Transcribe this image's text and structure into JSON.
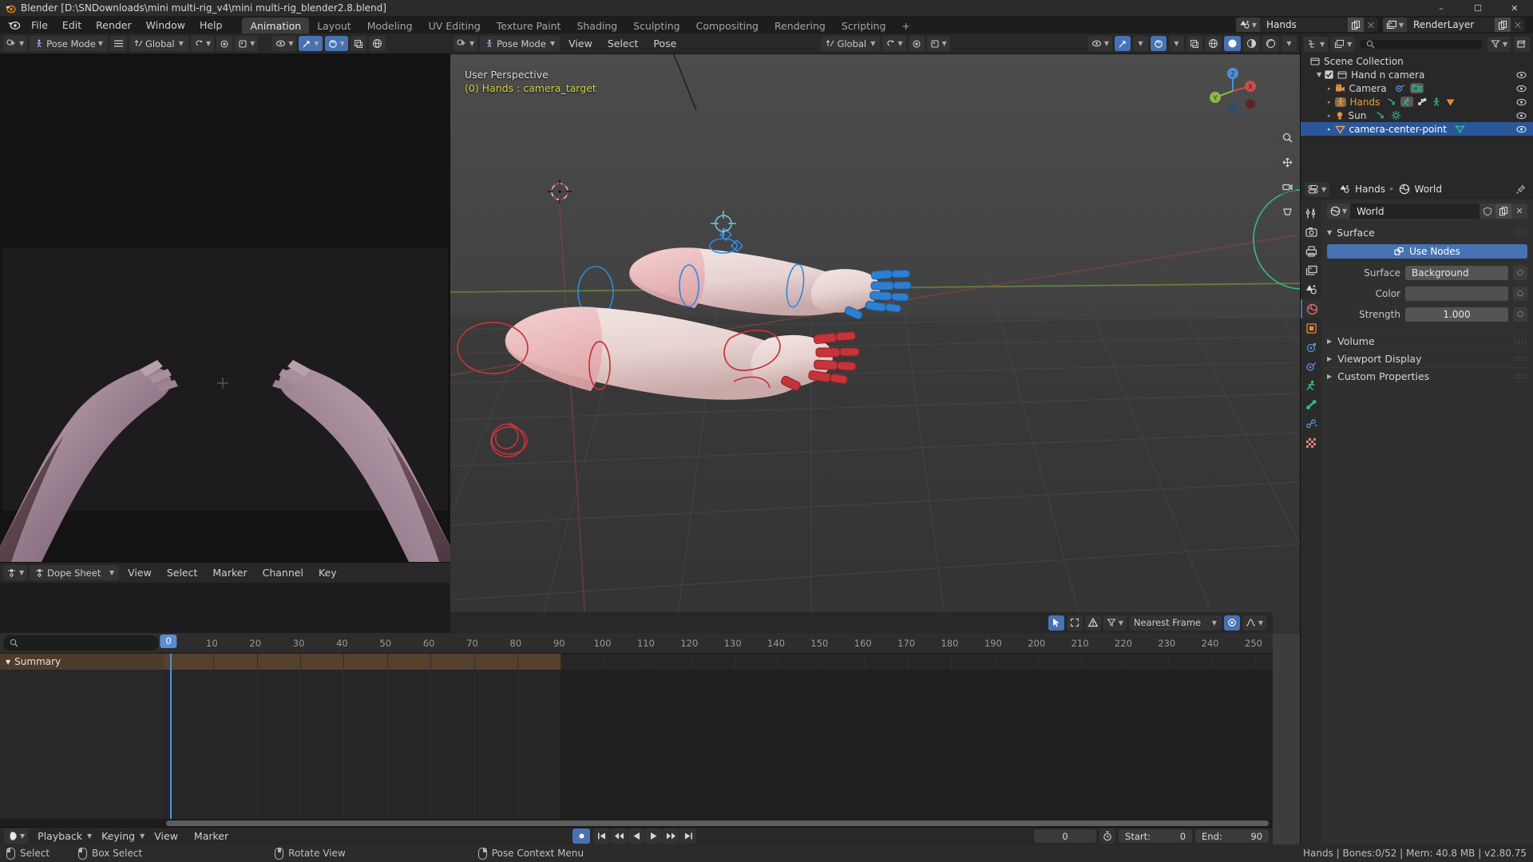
{
  "window": {
    "title": "Blender [D:\\SNDownloads\\mini multi-rig_v4\\mini multi-rig_blender2.8.blend]",
    "minimize": "–",
    "maximize": "☐",
    "close": "✕"
  },
  "menubar": {
    "items": [
      "File",
      "Edit",
      "Render",
      "Window",
      "Help"
    ],
    "workspaces": [
      {
        "label": "Animation",
        "active": true
      },
      {
        "label": "Layout",
        "active": false
      },
      {
        "label": "Modeling",
        "active": false
      },
      {
        "label": "UV Editing",
        "active": false
      },
      {
        "label": "Texture Paint",
        "active": false
      },
      {
        "label": "Shading",
        "active": false
      },
      {
        "label": "Sculpting",
        "active": false
      },
      {
        "label": "Compositing",
        "active": false
      },
      {
        "label": "Rendering",
        "active": false
      },
      {
        "label": "Scripting",
        "active": false
      },
      {
        "label": "+",
        "active": false
      }
    ],
    "scene_name": "Hands",
    "viewlayer_name": "RenderLayer"
  },
  "left_header": {
    "mode": "Pose Mode",
    "transform_orientation": "Global"
  },
  "viewport": {
    "mode": "Pose Mode",
    "menus": [
      "View",
      "Select",
      "Pose"
    ],
    "transform_orientation": "Global",
    "overlay_line1": "User Perspective",
    "overlay_line2": "(0) Hands : camera_target",
    "gizmo_axes": {
      "x": "X",
      "y": "Y",
      "z": "Z"
    }
  },
  "outliner": {
    "search_placeholder": "",
    "rows": [
      {
        "label": "Scene Collection",
        "indent": 0,
        "icon": "collection-icon",
        "selected": false,
        "eye": false,
        "checkbox": false,
        "expander": ""
      },
      {
        "label": "Hand n camera",
        "indent": 1,
        "icon": "collection-icon",
        "selected": false,
        "eye": true,
        "checkbox": true,
        "expander": "▼"
      },
      {
        "label": "Camera",
        "indent": 2,
        "icon": "camera-icon",
        "selected": false,
        "eye": true,
        "checkbox": false,
        "expander": "▸"
      },
      {
        "label": "Hands",
        "indent": 2,
        "icon": "armature-icon",
        "selected": false,
        "eye": true,
        "checkbox": false,
        "expander": "▸",
        "highlight": true
      },
      {
        "label": "Sun",
        "indent": 2,
        "icon": "light-icon",
        "selected": false,
        "eye": true,
        "checkbox": false,
        "expander": "▸"
      },
      {
        "label": "camera-center-point",
        "indent": 2,
        "icon": "empty-icon",
        "selected": true,
        "eye": true,
        "checkbox": false,
        "expander": "▸"
      }
    ]
  },
  "properties": {
    "breadcrumb": [
      "Hands",
      "World"
    ],
    "datablock_name": "World",
    "panel_surface": "Surface",
    "use_nodes_label": "Use Nodes",
    "fields": [
      {
        "label": "Surface",
        "value": "Background",
        "type": "enum"
      },
      {
        "label": "Color",
        "value": "",
        "type": "color"
      },
      {
        "label": "Strength",
        "value": "1.000",
        "type": "number"
      }
    ],
    "closed_panels": [
      "Volume",
      "Viewport Display",
      "Custom Properties"
    ],
    "tabs": [
      {
        "name": "tool-tab",
        "icon": "wrench-screwdriver-icon",
        "active": false
      },
      {
        "name": "render-tab",
        "icon": "camera-back-icon",
        "active": false
      },
      {
        "name": "output-tab",
        "icon": "printer-icon",
        "active": false
      },
      {
        "name": "viewlayer-tab",
        "icon": "images-icon",
        "active": false
      },
      {
        "name": "scene-tab",
        "icon": "cone-icon",
        "active": false
      },
      {
        "name": "world-tab",
        "icon": "globe-icon",
        "active": true
      },
      {
        "name": "object-tab",
        "icon": "square-icon",
        "active": false
      },
      {
        "name": "modifier-tab",
        "icon": "physics-icon",
        "active": false
      },
      {
        "name": "particles-tab",
        "icon": "constraint-icon",
        "active": false
      },
      {
        "name": "object-data-tab",
        "icon": "armature-data-icon",
        "active": false
      },
      {
        "name": "bone-tab",
        "icon": "bone-icon",
        "active": false
      },
      {
        "name": "bone-constraint-tab",
        "icon": "bone-constraint-icon",
        "active": false
      },
      {
        "name": "texture-tab",
        "icon": "checker-icon",
        "active": false
      }
    ]
  },
  "dopesheet": {
    "editor_name": "Dope Sheet",
    "menus": [
      "View",
      "Select",
      "Marker",
      "Channel",
      "Key"
    ],
    "search_placeholder": "",
    "snap_mode": "Nearest Frame",
    "channels": [
      {
        "label": "Summary",
        "expander": "▼"
      }
    ],
    "ruler_ticks": [
      0,
      10,
      20,
      30,
      40,
      50,
      60,
      70,
      80,
      90,
      100,
      110,
      120,
      130,
      140,
      150,
      160,
      170,
      180,
      190,
      200,
      210,
      220,
      230,
      240,
      250
    ],
    "current_frame": 0,
    "range_end_frame": 90
  },
  "timeline": {
    "menus": [
      "Playback",
      "Keying",
      "View",
      "Marker"
    ],
    "current_frame": "0",
    "start_label": "Start:",
    "start_value": "0",
    "end_label": "End:",
    "end_value": "90"
  },
  "statusbar": {
    "hints": [
      {
        "mouse": "l",
        "label": "Select"
      },
      {
        "mouse": "l",
        "label": "Box Select"
      },
      {
        "mouse": "m",
        "label": "Rotate View"
      },
      {
        "mouse": "r",
        "label": "Pose Context Menu"
      }
    ],
    "info": "Hands | Bones:0/52  | Mem: 40.8 MB | v2.80.75"
  },
  "colors": {
    "accent": "#4772b3",
    "highlight_orange": "#e8a33d",
    "playhead": "#4f93e0",
    "left_rig": "#b03a3a",
    "right_rig": "#2f7fd0"
  }
}
